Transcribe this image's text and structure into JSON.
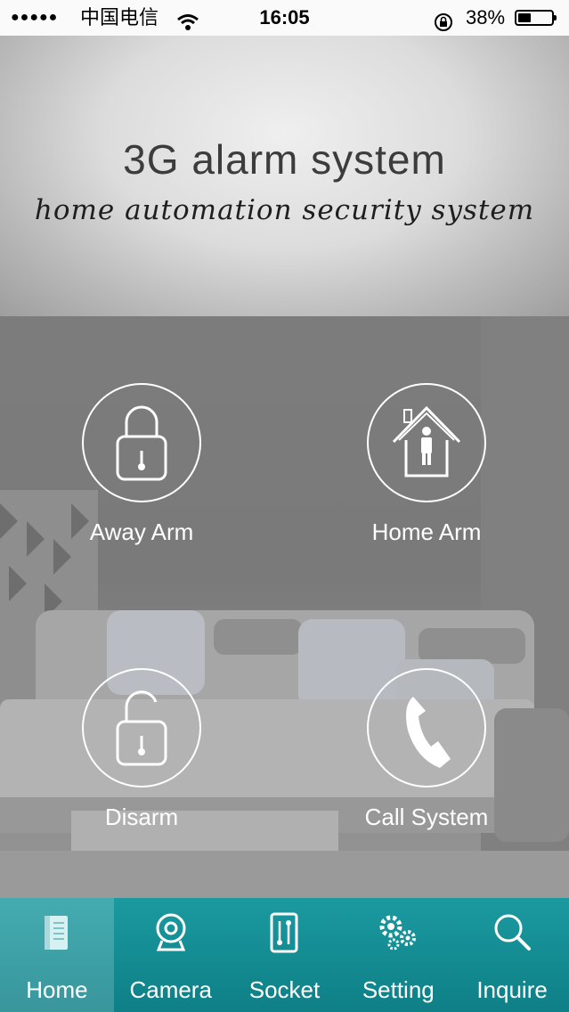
{
  "status_bar": {
    "signal": "●●●●●",
    "carrier": "中国电信",
    "time": "16:05",
    "battery_percent": "38%",
    "battery_level": 0.38
  },
  "header": {
    "title": "3G alarm system",
    "subtitle": "home automation security system"
  },
  "actions": {
    "away_arm": {
      "label": "Away Arm",
      "icon": "locked-padlock-icon"
    },
    "home_arm": {
      "label": "Home Arm",
      "icon": "house-person-icon"
    },
    "disarm": {
      "label": "Disarm",
      "icon": "unlocked-padlock-icon"
    },
    "call_system": {
      "label": "Call System",
      "icon": "phone-handset-icon"
    }
  },
  "tabs": [
    {
      "label": "Home",
      "icon": "home-book-icon",
      "active": true
    },
    {
      "label": "Camera",
      "icon": "camera-icon",
      "active": false
    },
    {
      "label": "Socket",
      "icon": "socket-switch-icon",
      "active": false
    },
    {
      "label": "Setting",
      "icon": "gears-icon",
      "active": false
    },
    {
      "label": "Inquire",
      "icon": "magnifier-icon",
      "active": false
    }
  ],
  "colors": {
    "tabbar": "#128a90",
    "icon_stroke": "#ffffff"
  }
}
